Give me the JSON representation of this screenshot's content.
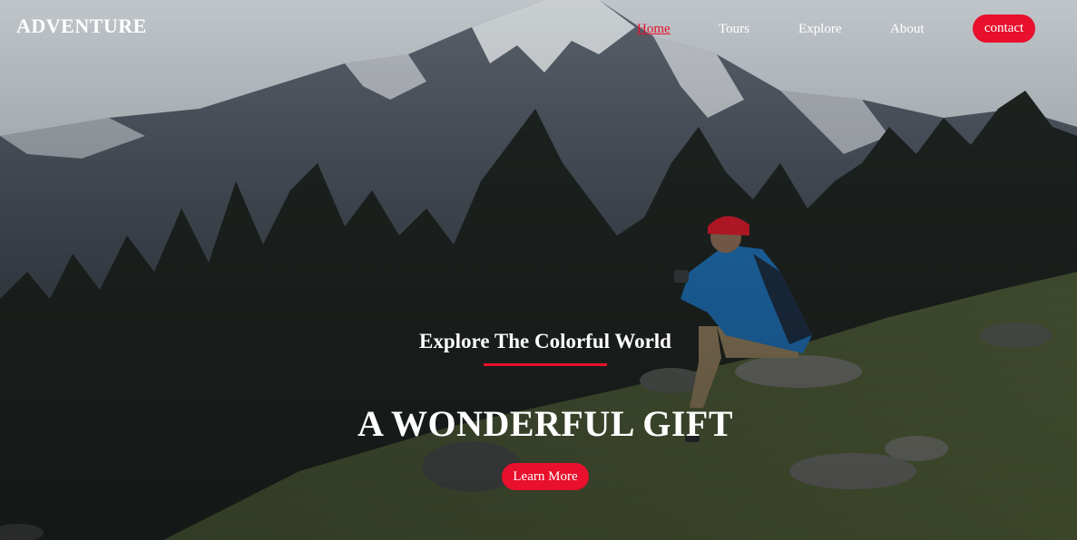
{
  "brand": {
    "logo_text": "ADVENTURE"
  },
  "nav": {
    "items": [
      {
        "label": "Home",
        "active": true
      },
      {
        "label": "Tours",
        "active": false
      },
      {
        "label": "Explore",
        "active": false
      },
      {
        "label": "About",
        "active": false
      }
    ],
    "contact_label": "contact"
  },
  "hero": {
    "subtitle": "Explore The Colorful World",
    "headline": "A WONDERFUL GIFT",
    "cta_label": "Learn More"
  },
  "colors": {
    "accent": "#e8102c",
    "text": "#ffffff"
  }
}
